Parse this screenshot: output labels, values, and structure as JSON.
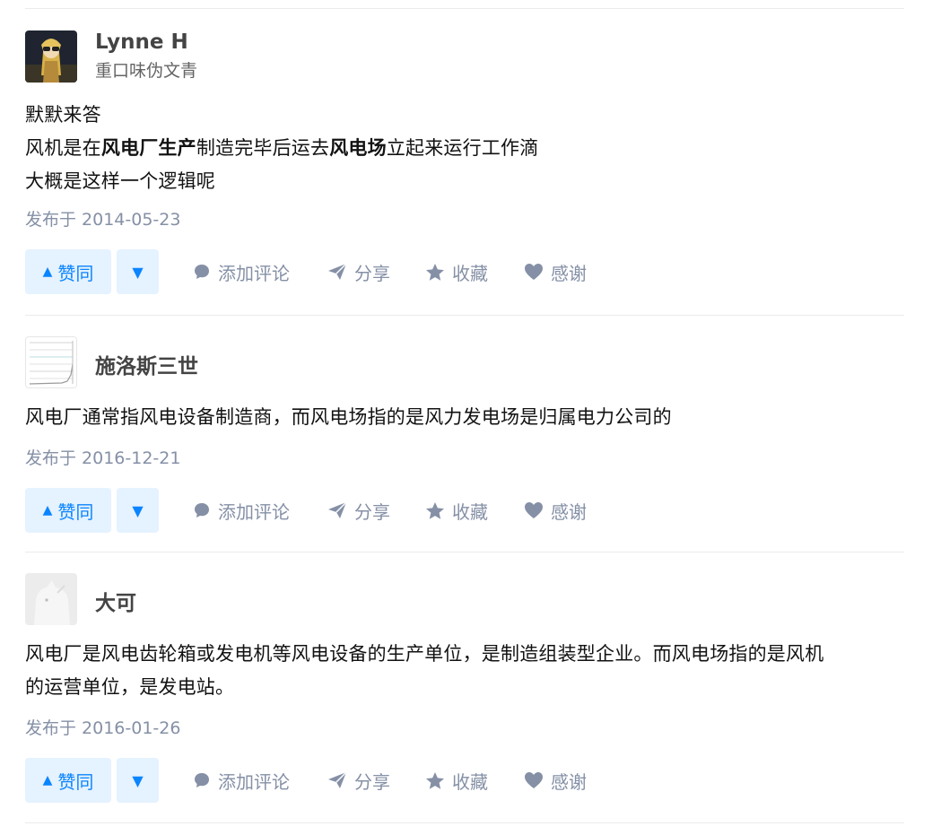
{
  "answers": [
    {
      "author": {
        "name": "Lynne H",
        "bio": "重口味伪文青"
      },
      "content": [
        [
          {
            "t": "默默来答",
            "b": false
          }
        ],
        [
          {
            "t": "风机是在",
            "b": false
          },
          {
            "t": "风电厂生产",
            "b": true
          },
          {
            "t": "制造完毕后运去",
            "b": false
          },
          {
            "t": "风电场",
            "b": true
          },
          {
            "t": "立起来运行工作滴",
            "b": false
          }
        ],
        [
          {
            "t": "大概是这样一个逻辑呢",
            "b": false
          }
        ]
      ],
      "date": "发布于 2014-05-23"
    },
    {
      "author": {
        "name": "施洛斯三世",
        "bio": ""
      },
      "content": [
        [
          {
            "t": "风电厂通常指风电设备制造商，而风电场指的是风力发电场是归属电力公司的",
            "b": false
          }
        ]
      ],
      "date": "发布于 2016-12-21"
    },
    {
      "author": {
        "name": "大可",
        "bio": ""
      },
      "content": [
        [
          {
            "t": "风电厂是风电齿轮箱或发电机等风电设备的生产单位，是制造组装型企业。而风电场指的是风机",
            "b": false
          }
        ],
        [
          {
            "t": "的运营单位，是发电站。",
            "b": false
          }
        ]
      ],
      "date": "发布于 2016-01-26"
    }
  ],
  "actions": {
    "upvote_label": "赞同",
    "upvote_glyph": "▲",
    "downvote_glyph": "▼",
    "comment_label": "添加评论",
    "share_label": "分享",
    "collect_label": "收藏",
    "thanks_label": "感谢"
  },
  "colors": {
    "accent": "#0a84ff",
    "accent_bg": "#e5f2ff",
    "meta_gray": "#8590a6",
    "divider": "#ebebeb"
  },
  "icons": [
    "comment-icon",
    "share-icon",
    "star-icon",
    "heart-icon",
    "upvote-triangle-icon",
    "downvote-triangle-icon"
  ]
}
